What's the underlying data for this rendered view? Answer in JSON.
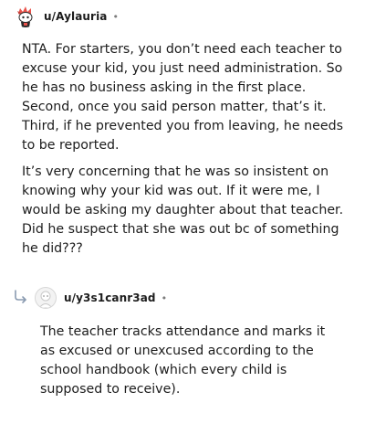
{
  "thread": {
    "top_comment": {
      "username": "u/Aylauria",
      "separator": "•",
      "paragraphs": [
        "NTA. For starters, you don’t need each teacher to excuse your kid, you just need administration. So he has no business asking in the first place. Second, once you said person matter, that’s it. Third, if he prevented you from leaving, he needs to be reported.",
        "It’s very concerning that he was so insistent on knowing why your kid was out. If it were me, I would be asking my daughter about that teacher. Did he suspect that she was out bc of something he did???"
      ],
      "avatar_icon": "snoo-avatar-icon",
      "avatar_colors": [
        "#e8524a",
        "#2b2b2b",
        "#ffffff"
      ]
    },
    "reply_comment": {
      "username": "u/y3s1canr3ad",
      "separator": "•",
      "paragraphs": [
        "The teacher tracks attendance and marks it as excused or unexcused according to the school handbook (which every child is supposed to receive)."
      ],
      "avatar_icon": "default-avatar-icon",
      "reply_icon": "reply-arrow-icon"
    }
  }
}
